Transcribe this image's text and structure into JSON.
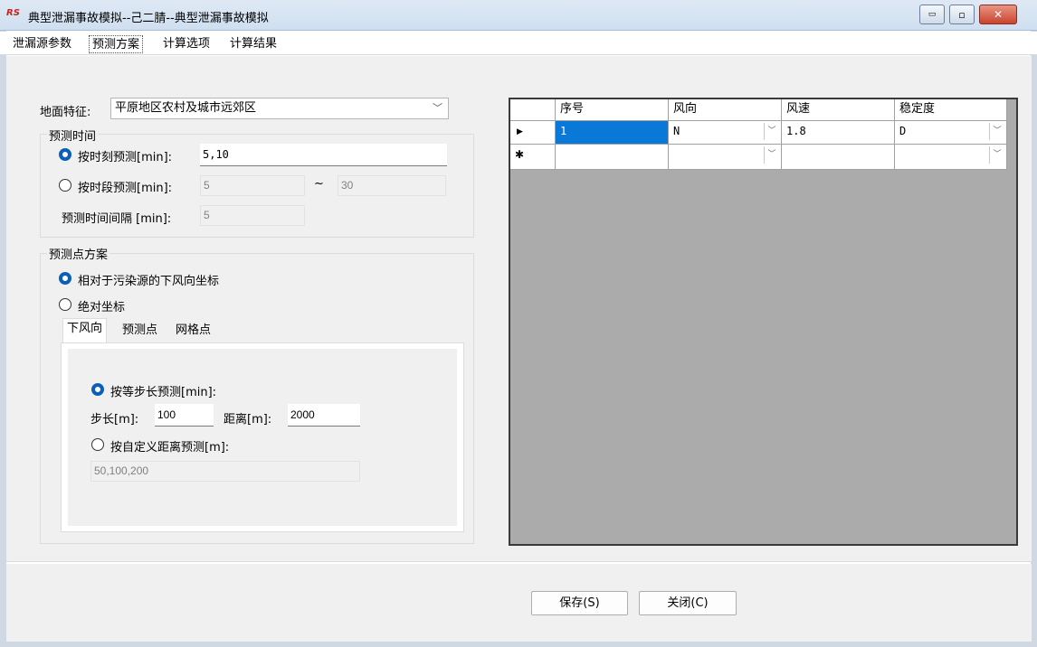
{
  "window": {
    "title": "典型泄漏事故模拟--己二腈--典型泄漏事故模拟",
    "icon_text": "RS",
    "controls": {
      "minimize": "▭",
      "maximize": "▫",
      "close": "✕"
    }
  },
  "tabs": [
    {
      "label": "泄漏源参数",
      "active": false
    },
    {
      "label": "预测方案",
      "active": true
    },
    {
      "label": "计算选项",
      "active": false
    },
    {
      "label": "计算结果",
      "active": false
    }
  ],
  "terrain": {
    "label": "地面特征:",
    "value": "平原地区农村及城市远郊区"
  },
  "predict_time": {
    "group_title": "预测时间",
    "by_moment": {
      "label": "按时刻预测[min]:",
      "value": "5,10",
      "selected": true
    },
    "by_period": {
      "label": "按时段预测[min]:",
      "from": "5",
      "separator": "~",
      "to": "30",
      "selected": false
    },
    "interval": {
      "label": "预测时间间隔 [min]:",
      "value": "5"
    }
  },
  "predict_points": {
    "group_title": "预测点方案",
    "relative": {
      "label": "相对于污染源的下风向坐标",
      "selected": true
    },
    "absolute": {
      "label": "绝对坐标",
      "selected": false
    },
    "subtabs": [
      {
        "label": "下风向",
        "active": true
      },
      {
        "label": "预测点",
        "active": false
      },
      {
        "label": "网格点",
        "active": false
      }
    ],
    "equal_step": {
      "label": "按等步长预测[min]:",
      "selected": true
    },
    "step": {
      "label": "步长[m]:",
      "value": "100"
    },
    "distance": {
      "label": "距离[m]:",
      "value": "2000"
    },
    "custom": {
      "label": "按自定义距离预测[m]:",
      "selected": false,
      "value": "50,100,200"
    }
  },
  "grid": {
    "columns": [
      "序号",
      "风向",
      "风速",
      "稳定度"
    ],
    "rows": [
      {
        "indicator": "▶",
        "no": "1",
        "wind_dir": "N",
        "wind_speed": "1.8",
        "stability": "D"
      },
      {
        "indicator": "✱",
        "no": "",
        "wind_dir": "",
        "wind_speed": "",
        "stability": ""
      }
    ]
  },
  "footer": {
    "save": "保存(S)",
    "close": "关闭(C)"
  },
  "icons": {
    "dropdown": "chevron-down-icon",
    "row_current": "current-row-icon",
    "row_new": "new-row-icon"
  },
  "colors": {
    "radio_selected": "#0b5fb8",
    "cell_selected": "#0a78d7",
    "grid_background": "#ababab"
  }
}
